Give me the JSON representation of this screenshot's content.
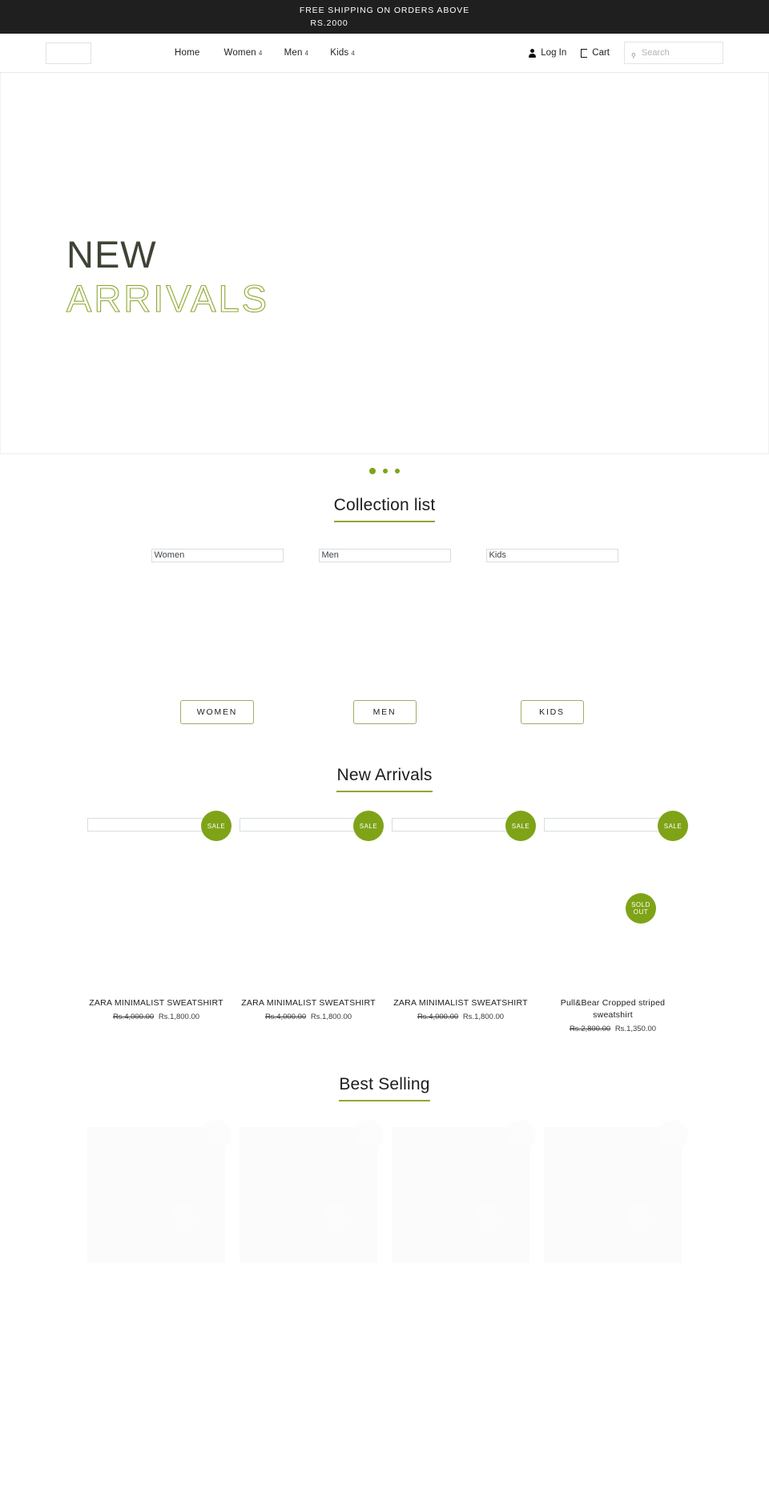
{
  "announcement": {
    "line1": "FREE SHIPPING ON ORDERS ABOVE",
    "line2": "RS.2000"
  },
  "header": {
    "logo_alt": "",
    "nav": [
      {
        "label": "Home",
        "count": ""
      },
      {
        "label": "Women",
        "count": "4"
      },
      {
        "label": "Men",
        "count": "4"
      },
      {
        "label": "Kids",
        "count": "4"
      }
    ],
    "account_label": "Log In",
    "cart_label": "Cart",
    "search_placeholder": "Search",
    "search_value": "",
    "icons": {
      "account": "person-icon",
      "cart": "shopping-bag-icon",
      "search": "search-icon"
    }
  },
  "hero": {
    "line1": "NEW",
    "line2": "ARRIVALS",
    "dots": 3,
    "active_dot": 1
  },
  "collection_section": {
    "title": "Collection list",
    "items": [
      {
        "alt": "Women",
        "button": "WOMEN"
      },
      {
        "alt": "Men",
        "button": "MEN"
      },
      {
        "alt": "Kids",
        "button": "KIDS"
      }
    ]
  },
  "new_arrivals": {
    "title": "New Arrivals",
    "products": [
      {
        "alt": "",
        "name": "ZARA MINIMALIST SWEATSHIRT",
        "compare_price": "Rs.4,000.00",
        "price": "Rs.1,800.00",
        "badge": "SALE"
      },
      {
        "alt": "",
        "name": "ZARA MINIMALIST SWEATSHIRT",
        "compare_price": "Rs.4,000.00",
        "price": "Rs.1,800.00",
        "badge": "SALE"
      },
      {
        "alt": "",
        "name": "ZARA MINIMALIST SWEATSHIRT",
        "compare_price": "Rs.4,000.00",
        "price": "Rs.1,800.00",
        "badge": "SALE"
      },
      {
        "alt": "",
        "name": "Pull&Bear Cropped striped sweatshirt",
        "compare_price": "Rs.2,800.00",
        "price": "Rs.1,350.00",
        "badge": "SALE",
        "badge2": "SOLD OUT"
      }
    ]
  },
  "best_selling": {
    "title": "Best Selling"
  },
  "colors": {
    "accent": "#7fa317",
    "accent_border": "#a4ac63",
    "announcement_bg": "#1f1f1f",
    "hero_text": "#3d4436",
    "hero_outline": "#8ea832"
  }
}
